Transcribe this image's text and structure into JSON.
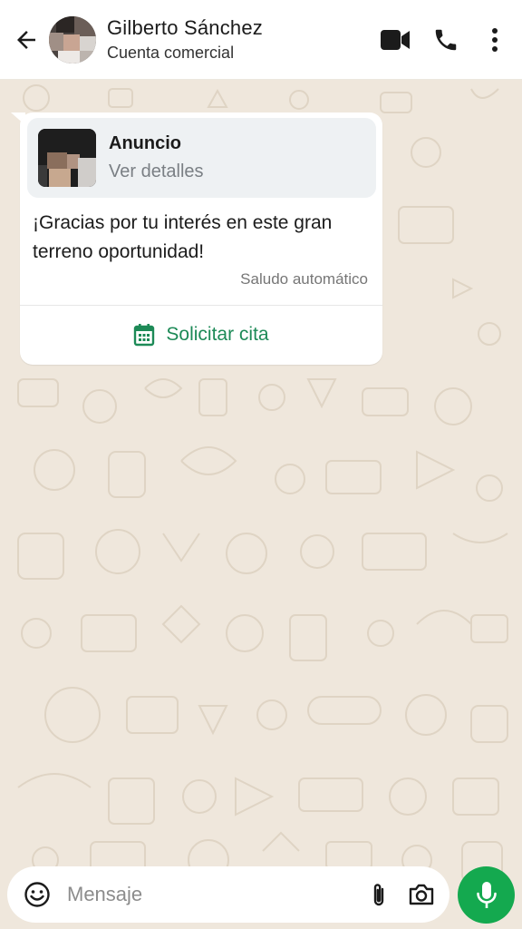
{
  "header": {
    "contact_name": "Gilberto Sánchez",
    "contact_subtitle": "Cuenta comercial",
    "icons": [
      "back-arrow-icon",
      "video-call-icon",
      "phone-icon",
      "more-options-icon"
    ]
  },
  "message": {
    "ad": {
      "title": "Anuncio",
      "link": "Ver detalles"
    },
    "text": "¡Gracias por tu interés en este gran terreno oportunidad!",
    "meta": "Saludo automático",
    "cta_label": "Solicitar cita",
    "cta_icon": "calendar-icon"
  },
  "composer": {
    "placeholder": "Mensaje",
    "icons": [
      "emoji-icon",
      "attach-icon",
      "camera-icon",
      "microphone-icon"
    ]
  },
  "colors": {
    "accent_green": "#1d8a57",
    "mic_button": "#14a94f",
    "chat_background": "#efe7dc",
    "ad_card": "#eef1f3"
  }
}
